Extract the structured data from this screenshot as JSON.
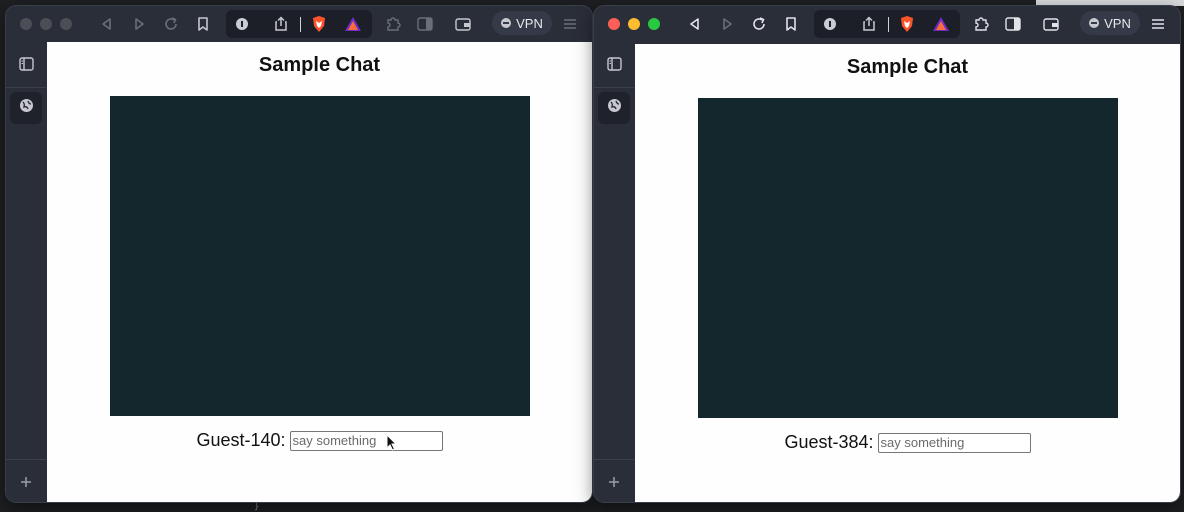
{
  "windows": [
    {
      "page": {
        "title": "Sample Chat",
        "guest_label": "Guest-140:",
        "input_placeholder": "say something"
      },
      "toolbar": {
        "vpn_label": "VPN"
      },
      "traffic_colors": [
        "#4b4e55",
        "#4b4e55",
        "#4b4e55"
      ]
    },
    {
      "page": {
        "title": "Sample Chat",
        "guest_label": "Guest-384:",
        "input_placeholder": "say something"
      },
      "toolbar": {
        "vpn_label": "VPN"
      },
      "traffic_colors": [
        "#fe5f57",
        "#febc2e",
        "#28c840"
      ]
    }
  ],
  "colors": {
    "chat_area": "#13272d",
    "browser_chrome": "#2a2e39"
  },
  "icons": [
    "back-icon",
    "forward-icon",
    "reload-icon",
    "bookmark-icon",
    "site-info-icon",
    "share-icon",
    "brave-shields-icon",
    "brave-rewards-icon",
    "extensions-icon",
    "sidebar-toggle-icon",
    "wallet-icon",
    "vpn-icon",
    "menu-icon",
    "sidebar-panel-icon",
    "globe-icon",
    "add-icon"
  ]
}
